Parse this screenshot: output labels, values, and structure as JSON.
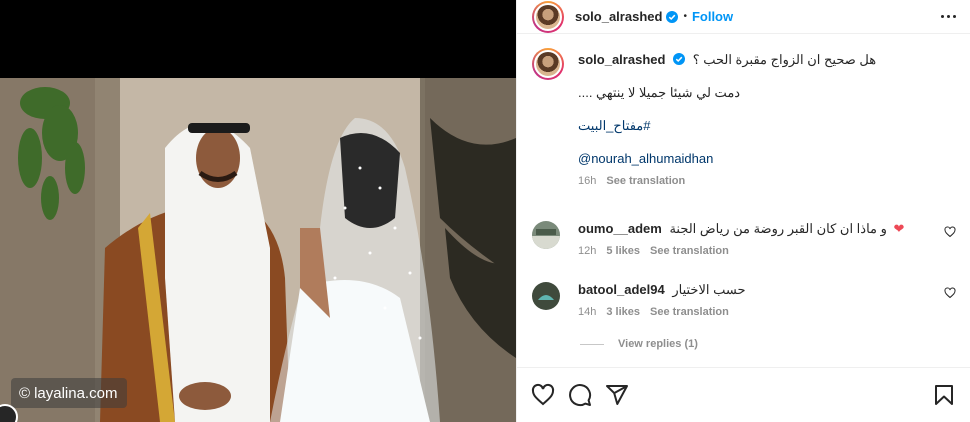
{
  "post": {
    "username": "solo_alrashed",
    "follow_label": "Follow",
    "separator": "•"
  },
  "caption": {
    "username": "solo_alrashed",
    "text": "هل صحيح ان الزواج مقبرة الحب ؟",
    "line2": "دمت لي شيئا جميلا لا ينتهي ....",
    "hashtag": "#مفتاح_البيت",
    "mention": "@nourah_alhumaidhan",
    "time": "16h",
    "see_translation": "See translation"
  },
  "comments": [
    {
      "username": "oumo__adem",
      "text": "و ماذا ان كان القبر روضة من رياض الجنة",
      "emoji": "❤",
      "time": "12h",
      "likes": "5 likes",
      "see_translation": "See translation"
    },
    {
      "username": "batool_adel94",
      "text": "حسب الاختيار",
      "time": "14h",
      "likes": "3 likes",
      "see_translation": "See translation"
    }
  ],
  "view_replies": "View replies (1)",
  "watermark": {
    "symbol": "©",
    "text": "layalina.com"
  },
  "colors": {
    "link": "#0095f6",
    "hashtag": "#00376b",
    "muted": "#8e8e8e",
    "heart": "#ed4956"
  },
  "icons": [
    "verified-badge-icon",
    "more-options-icon",
    "like-icon",
    "comment-icon",
    "share-icon",
    "bookmark-icon",
    "comment-like-icon"
  ]
}
